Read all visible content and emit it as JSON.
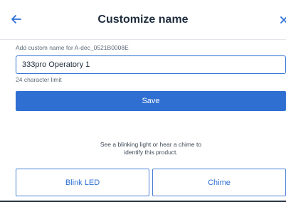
{
  "header": {
    "title": "Customize name",
    "back_icon": "arrow-left-icon",
    "close_icon": "close-icon"
  },
  "form": {
    "label": "Add custom name for A-dec_0521B0008E",
    "value": "333pro Operatory 1",
    "char_limit_text": "24 character limit",
    "save_label": "Save"
  },
  "identify": {
    "hint_line1": "See a blinking light or hear a chime to",
    "hint_line2": "identify this product.",
    "blink_label": "Blink LED",
    "chime_label": "Chime"
  },
  "colors": {
    "accent": "#2f6fd2",
    "text": "#1f2d3d",
    "muted": "#5f6b78"
  }
}
